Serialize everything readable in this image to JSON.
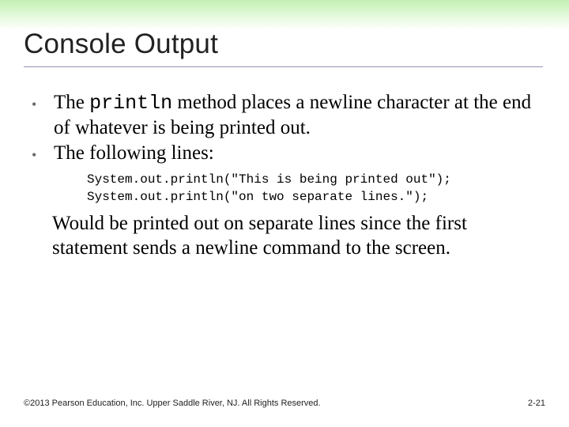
{
  "title": "Console Output",
  "bullets": [
    {
      "pre": "The ",
      "mono": "println",
      "post": " method places a newline character at the end of whatever is being printed out."
    },
    {
      "text": "The following lines:"
    }
  ],
  "code": {
    "line1": "System.out.println(\"This is being printed out\");",
    "line2": "System.out.println(\"on two separate lines.\");"
  },
  "after": "Would be printed out on separate lines since the first statement sends a newline command to the screen.",
  "footer": {
    "copyright": "©2013 Pearson Education, Inc. Upper Saddle River, NJ. All Rights Reserved.",
    "pagenum": "2-21"
  }
}
